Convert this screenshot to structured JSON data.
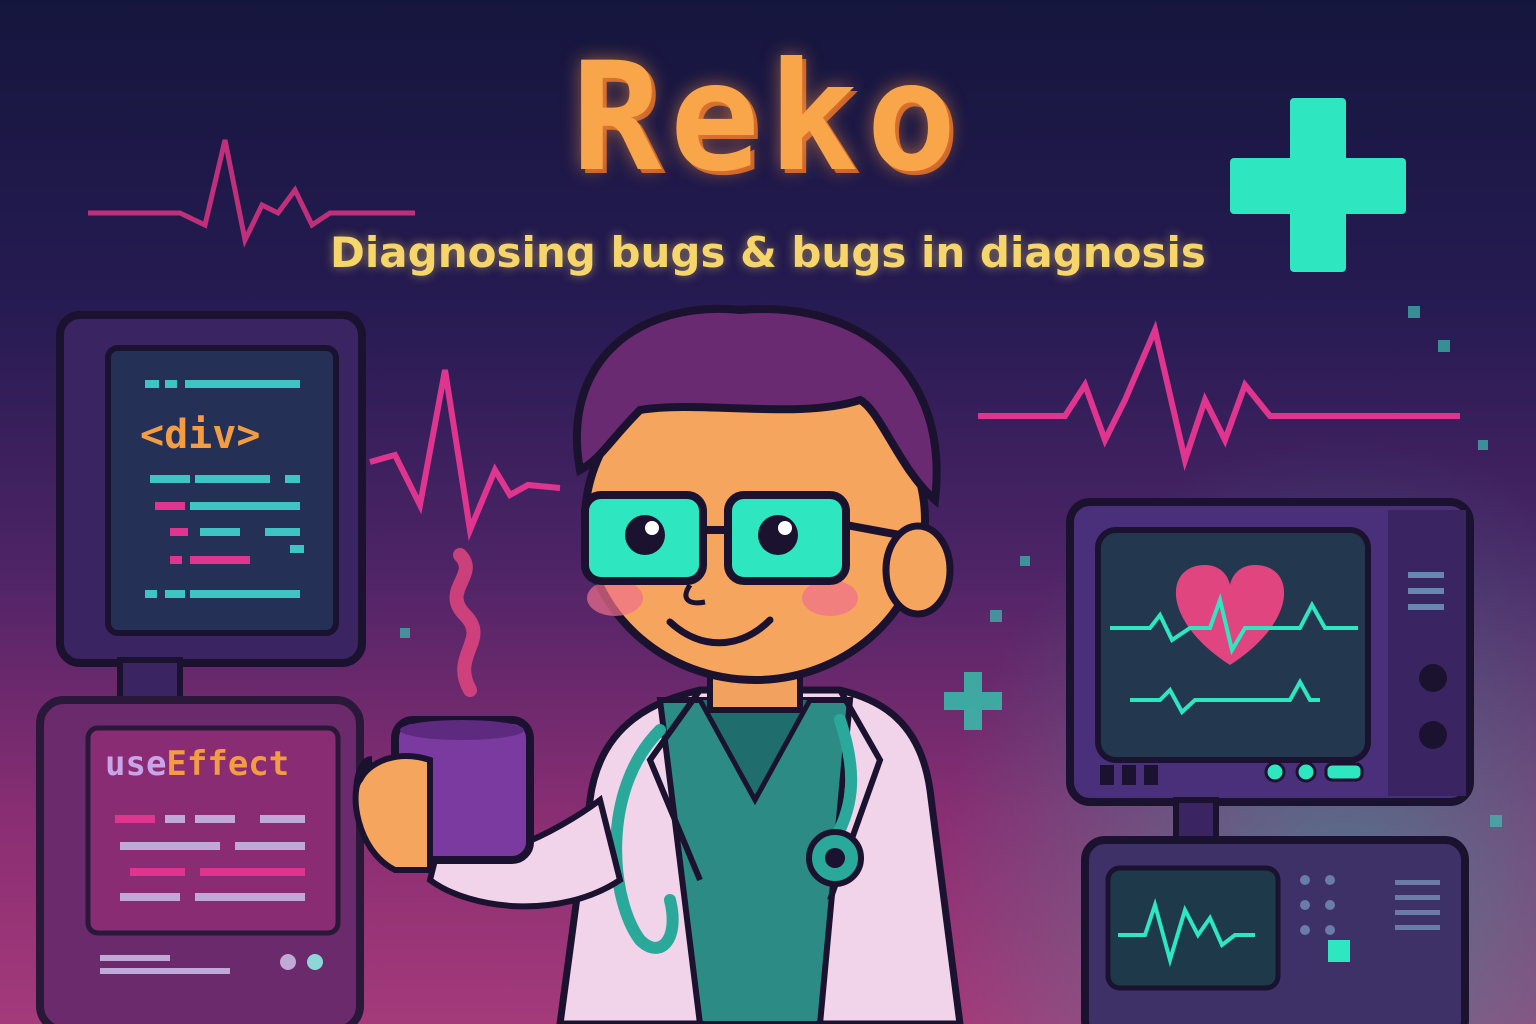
{
  "title": "Reko",
  "subtitle": "Diagnosing bugs & bugs in diagnosis",
  "left_monitor": {
    "code_tag": "<div>"
  },
  "left_panel": {
    "hook_prefix": "use",
    "hook_suffix": "Effect"
  },
  "colors": {
    "title": "#f9a64a",
    "subtitle": "#f6d66a",
    "teal": "#2ee6c0",
    "pink": "#e0358f",
    "background_top": "#15163d",
    "background_bottom": "#a43a7a"
  },
  "icons": [
    "medical-cross-icon",
    "heartbeat-line-icon",
    "heart-icon",
    "stethoscope-icon",
    "coffee-mug-icon",
    "glasses-icon"
  ]
}
